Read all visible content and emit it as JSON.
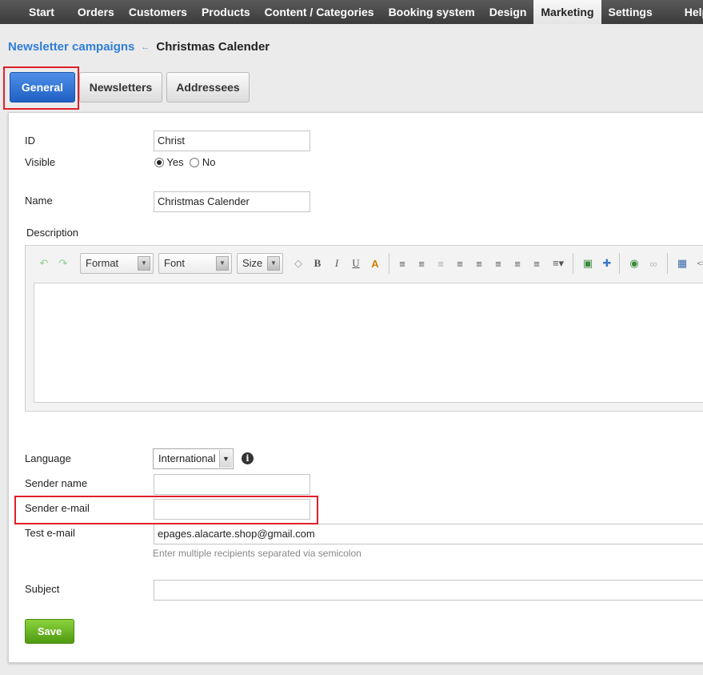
{
  "topnav": {
    "items": [
      {
        "label": "Start"
      },
      {
        "label": "Orders"
      },
      {
        "label": "Customers"
      },
      {
        "label": "Products"
      },
      {
        "label": "Content / Categories"
      },
      {
        "label": "Booking system"
      },
      {
        "label": "Design"
      },
      {
        "label": "Marketing"
      },
      {
        "label": "Settings"
      },
      {
        "label": "Help"
      }
    ],
    "active": "Marketing"
  },
  "breadcrumb": {
    "parent": "Newsletter campaigns",
    "current": "Christmas Calender"
  },
  "tabs": {
    "general": "General",
    "newsletters": "Newsletters",
    "addressees": "Addressees"
  },
  "form": {
    "id_label": "ID",
    "id_value": "Christ",
    "visible_label": "Visible",
    "visible_yes": "Yes",
    "visible_no": "No",
    "visible_selected": "Yes",
    "name_label": "Name",
    "name_value": "Christmas Calender",
    "description_label": "Description",
    "language_label": "Language",
    "language_value": "International",
    "sender_name_label": "Sender name",
    "sender_name_value": "",
    "sender_email_label": "Sender e-mail",
    "sender_email_value": "",
    "test_email_label": "Test e-mail",
    "test_email_value": "epages.alacarte.shop@gmail.com",
    "test_email_hint": "Enter multiple recipients separated via semicolon",
    "subject_label": "Subject",
    "subject_value": "",
    "save_label": "Save"
  },
  "editor": {
    "format_label": "Format",
    "font_label": "Font",
    "size_label": "Size"
  },
  "colors": {
    "accent": "#2f7ed8",
    "active_tab": "#2a6fd6",
    "save": "#6cb427",
    "highlight": "#e0202a"
  }
}
